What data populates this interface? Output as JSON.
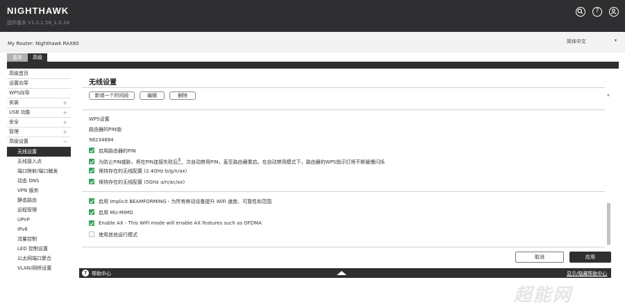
{
  "header": {
    "logo": "NIGHTHAWK",
    "firmware": "固件版本 V1.0.1.58_1.0.24",
    "icons": [
      "search-icon",
      "help-icon",
      "user-icon"
    ]
  },
  "subheader": {
    "my_router": "My Router: Nighthawk RAX80",
    "language": "简体中文"
  },
  "tabs": [
    {
      "label": "基本",
      "active": false
    },
    {
      "label": "高级",
      "active": true
    }
  ],
  "sidebar": {
    "items": [
      {
        "label": "高级首页",
        "expandable": false
      },
      {
        "label": "设置向导",
        "expandable": false
      },
      {
        "label": "WPS向导",
        "expandable": false
      },
      {
        "label": "安装",
        "expandable": true,
        "state": "+"
      },
      {
        "label": "USB 功能",
        "expandable": true,
        "state": "+"
      },
      {
        "label": "安全",
        "expandable": true,
        "state": "+"
      },
      {
        "label": "管理",
        "expandable": true,
        "state": "+"
      },
      {
        "label": "高级设置",
        "expandable": true,
        "state": "−"
      }
    ],
    "subitems": [
      {
        "label": "无线设置",
        "active": true
      },
      {
        "label": "无线接入点",
        "active": false
      },
      {
        "label": "端口映射/端口触发",
        "active": false
      },
      {
        "label": "动态 DNS",
        "active": false
      },
      {
        "label": "VPN 服务",
        "active": false
      },
      {
        "label": "静态路由",
        "active": false
      },
      {
        "label": "远程管理",
        "active": false
      },
      {
        "label": "UPnP",
        "active": false
      },
      {
        "label": "IPv6",
        "active": false
      },
      {
        "label": "流量控制",
        "active": false
      },
      {
        "label": "LED 控制设置",
        "active": false
      },
      {
        "label": "以太网端口聚合",
        "active": false
      },
      {
        "label": "VLAN/网桥设置",
        "active": false
      }
    ]
  },
  "main": {
    "title": "无线设置",
    "schedule_buttons": [
      "新增一个时间段",
      "编辑",
      "删除"
    ],
    "wps_heading": "WPS设置",
    "pin_label": "路由器的PIN值:",
    "pin_value": "98234684",
    "options": [
      {
        "label": "启用路由器的PIN",
        "checked": true
      },
      {
        "label_pre": "为防止PIN威胁，将在PIN连接失败后",
        "value": "3",
        "label_post": "次自动禁用PIN，直至路由器重启。在自动禁用模式下，路由器的WPS指示灯将不断缓慢闪烁",
        "checked": true
      },
      {
        "label": "保持存在的无线配置 (2.4GHz b/g/n/ax)",
        "checked": true
      },
      {
        "label": "保持存在的无线配置 (5GHz a/n/ac/ax)",
        "checked": true
      }
    ],
    "advanced_options": [
      {
        "label": "启用 Implicit BEAMFORMING - 为所有移动设备提升 WiFi 速度、可靠性和范围",
        "checked": true
      },
      {
        "label": "启用 MU-MIMO",
        "checked": true
      },
      {
        "label": "Enable AX - This WiFi mode will enable AX features such as OFDMA",
        "checked": true
      },
      {
        "label": "使用其他运行模式",
        "checked": false
      }
    ],
    "cancel_label": "取消",
    "apply_label": "应用"
  },
  "helpbar": {
    "label": "帮助中心",
    "toggle_label": "显示/隐藏帮助中心"
  },
  "watermark": "超能网"
}
